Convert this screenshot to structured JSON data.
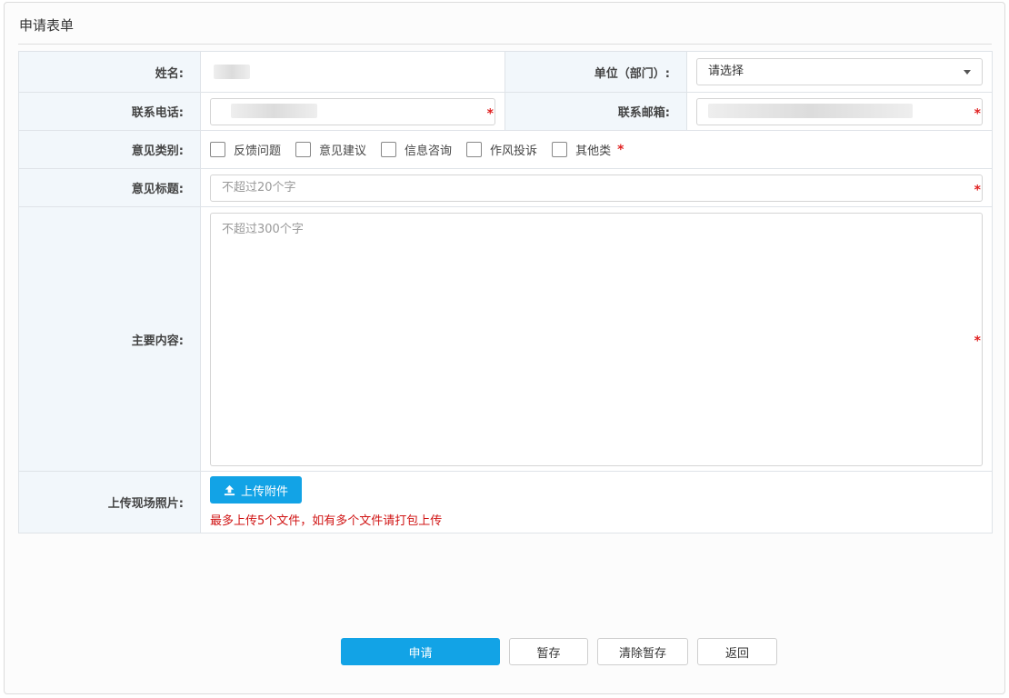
{
  "panel": {
    "title": "申请表单"
  },
  "form": {
    "name": {
      "label": "姓名:"
    },
    "unit": {
      "label": "单位（部门）:",
      "value": "请选择"
    },
    "phone": {
      "label": "联系电话:",
      "required": "*"
    },
    "email": {
      "label": "联系邮箱:",
      "required": "*"
    },
    "category": {
      "label": "意见类别:",
      "options": [
        "反馈问题",
        "意见建议",
        "信息咨询",
        "作风投诉",
        "其他类"
      ],
      "required": "*"
    },
    "subject": {
      "label": "意见标题:",
      "placeholder": "不超过20个字",
      "required": "*"
    },
    "content": {
      "label": "主要内容:",
      "placeholder": "不超过300个字",
      "required": "*"
    },
    "upload": {
      "label": "上传现场照片:",
      "button": "上传附件",
      "note": "最多上传5个文件，如有多个文件请打包上传"
    }
  },
  "actions": {
    "submit": "申请",
    "save": "暂存",
    "clear": "清除暂存",
    "back": "返回"
  },
  "colors": {
    "primary": "#12a3e6",
    "required": "#e02020",
    "label_bg": "#f2f7fb"
  }
}
